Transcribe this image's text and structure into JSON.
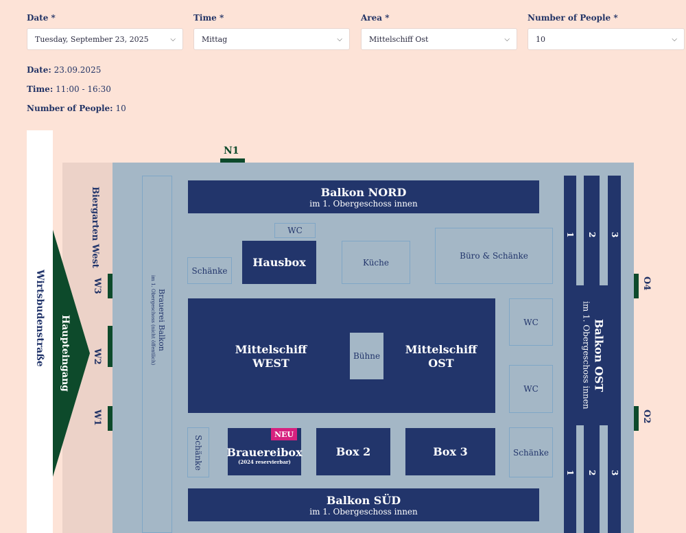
{
  "form": {
    "date": {
      "label": "Date *",
      "value": "Tuesday, September 23, 2025"
    },
    "time": {
      "label": "Time *",
      "value": "Mittag"
    },
    "area": {
      "label": "Area *",
      "value": "Mittelschiff Ost"
    },
    "people": {
      "label": "Number of People *",
      "value": "10"
    }
  },
  "summary": {
    "date_label": "Date:",
    "date_value": "23.09.2025",
    "time_label": "Time:",
    "time_value": "11:00 - 16:30",
    "people_label": "Number of People:",
    "people_value": "10"
  },
  "floorplan": {
    "street": "Wirtsbudenstraße",
    "entrance": "Haupteingang",
    "biergarten": "Biergarten West",
    "brauerei_balkon": "Brauerei Balkon",
    "brauerei_balkon_sub": "im 1. Obergeschoss (nicht öffentlich)",
    "n1": "N1",
    "w1": "W1",
    "w2": "W2",
    "w3": "W3",
    "o2": "O2",
    "o4": "O4",
    "balkon_nord": "Balkon NORD",
    "balkon_nord_sub": "im 1. Obergeschoss innen",
    "balkon_sued": "Balkon SÜD",
    "balkon_sued_sub": "im 1. Obergeschoss innen",
    "balkon_ost": "Balkon OST",
    "balkon_ost_sub": "im 1. Obergeschoss innen",
    "wc": "WC",
    "schaenke": "Schänke",
    "hausbox": "Hausbox",
    "kueche": "Küche",
    "buero": "Büro & Schänke",
    "mittelschiff_west": "Mittelschiff WEST",
    "mittelschiff_ost": "Mittelschiff OST",
    "buehne": "Bühne",
    "brauereibox": "Brauereibox",
    "brauereibox_sub": "(2024 reservierbar)",
    "neu": "NEU",
    "box2": "Box 2",
    "box3": "Box 3",
    "col1": "1",
    "col2": "2",
    "col3": "3",
    "colors": {
      "navy": "#22356b",
      "green": "#0d4a2b",
      "hall": "#a4b7c6",
      "badge": "#d6217f"
    }
  }
}
